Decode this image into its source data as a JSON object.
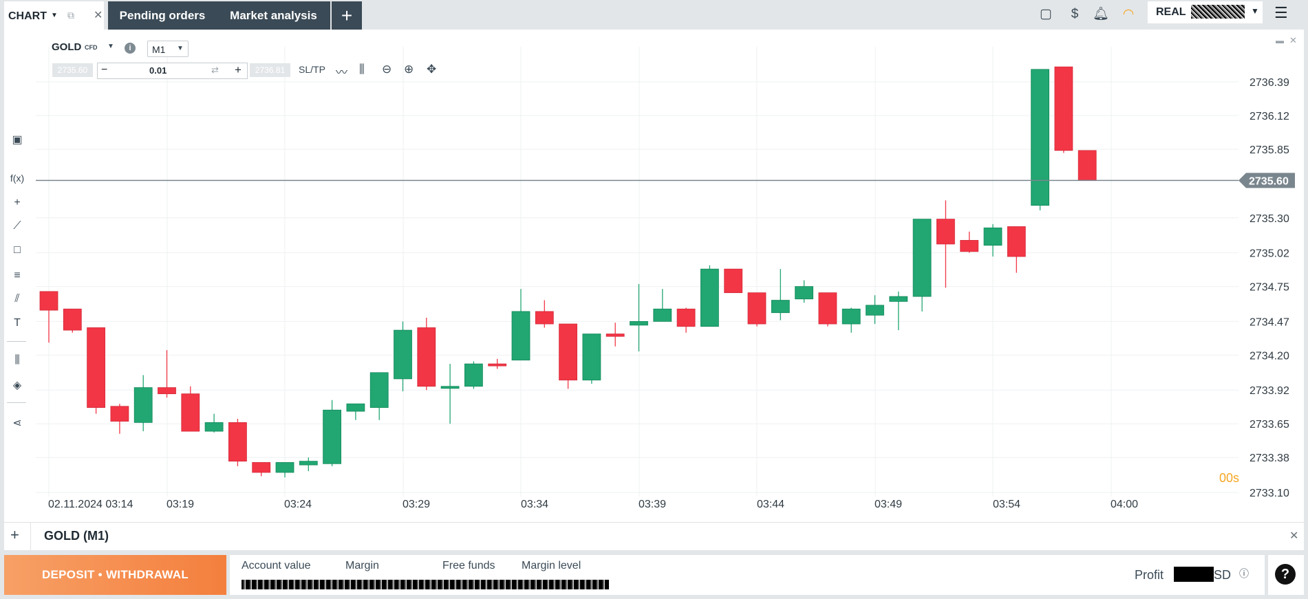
{
  "top_bar": {
    "chart_tab": {
      "label": "CHART",
      "close": "✕",
      "open_external": "⧉"
    },
    "tabs": [
      {
        "label": "Pending orders"
      },
      {
        "label": "Market analysis"
      }
    ],
    "add_tab": "+",
    "icons": [
      "layout-icon",
      "dollar-transfer-icon",
      "bell-icon",
      "signal-icon"
    ],
    "account_type": "REAL",
    "menu": "☰"
  },
  "chart_header": {
    "symbol": "GOLD",
    "type_badge": "CFD",
    "timeframe": "M1",
    "sell_price": "2735.60",
    "buy_price": "2736.81",
    "lot_size": "0.01",
    "lot_minus": "−",
    "lot_plus": "+",
    "lot_swap": "⇄",
    "sltp_label": "SL/TP"
  },
  "left_tools": [
    {
      "name": "chart-type-tool",
      "glyph": "▣"
    },
    {
      "name": "indicators-tool",
      "glyph": "f(x)"
    },
    {
      "name": "crosshair-tool",
      "glyph": "+"
    },
    {
      "name": "trendline-tool",
      "glyph": "⟋"
    },
    {
      "name": "rectangle-tool",
      "glyph": "□"
    },
    {
      "name": "fibonacci-tool",
      "glyph": "≡"
    },
    {
      "name": "pitchfork-tool",
      "glyph": "⫽"
    },
    {
      "name": "text-tool",
      "glyph": "T"
    },
    {
      "name": "candle-settings-tool",
      "glyph": "⫼"
    },
    {
      "name": "layers-tool",
      "glyph": "◈"
    },
    {
      "name": "share-tool",
      "glyph": "⋖"
    }
  ],
  "chart_data": {
    "type": "candlestick",
    "colors": {
      "up": "#22a672",
      "down": "#f23645",
      "current_price_line": "#7a868e"
    },
    "y_ticks": [
      "2736.39",
      "2736.12",
      "2735.85",
      "2735.60",
      "2735.30",
      "2735.02",
      "2734.75",
      "2734.47",
      "2734.20",
      "2733.92",
      "2733.65",
      "2733.38",
      "2733.10"
    ],
    "current_price": "2735.60",
    "x_ticks": [
      "02.11.2024 03:14",
      "03:19",
      "03:24",
      "03:29",
      "03:34",
      "03:39",
      "03:44",
      "03:49",
      "03:54",
      "04:00"
    ],
    "countdown": "00s",
    "candles": [
      {
        "o": 2734.71,
        "h": 2734.71,
        "l": 2734.3,
        "c": 2734.56
      },
      {
        "o": 2734.57,
        "h": 2734.57,
        "l": 2734.38,
        "c": 2734.4
      },
      {
        "o": 2734.42,
        "h": 2734.42,
        "l": 2733.73,
        "c": 2733.78
      },
      {
        "o": 2733.79,
        "h": 2733.81,
        "l": 2733.57,
        "c": 2733.67
      },
      {
        "o": 2733.66,
        "h": 2734.04,
        "l": 2733.59,
        "c": 2733.94
      },
      {
        "o": 2733.94,
        "h": 2734.24,
        "l": 2733.86,
        "c": 2733.89
      },
      {
        "o": 2733.89,
        "h": 2733.95,
        "l": 2733.59,
        "c": 2733.59
      },
      {
        "o": 2733.59,
        "h": 2733.73,
        "l": 2733.58,
        "c": 2733.66
      },
      {
        "o": 2733.66,
        "h": 2733.69,
        "l": 2733.31,
        "c": 2733.35
      },
      {
        "o": 2733.34,
        "h": 2733.34,
        "l": 2733.23,
        "c": 2733.26
      },
      {
        "o": 2733.26,
        "h": 2733.34,
        "l": 2733.22,
        "c": 2733.34
      },
      {
        "o": 2733.32,
        "h": 2733.38,
        "l": 2733.27,
        "c": 2733.35
      },
      {
        "o": 2733.33,
        "h": 2733.84,
        "l": 2733.31,
        "c": 2733.76
      },
      {
        "o": 2733.75,
        "h": 2733.81,
        "l": 2733.68,
        "c": 2733.81
      },
      {
        "o": 2733.78,
        "h": 2734.02,
        "l": 2733.68,
        "c": 2734.06
      },
      {
        "o": 2734.01,
        "h": 2734.47,
        "l": 2733.91,
        "c": 2734.4
      },
      {
        "o": 2734.42,
        "h": 2734.5,
        "l": 2733.92,
        "c": 2733.95
      },
      {
        "o": 2733.94,
        "h": 2734.13,
        "l": 2733.65,
        "c": 2733.95
      },
      {
        "o": 2733.95,
        "h": 2734.15,
        "l": 2733.93,
        "c": 2734.13
      },
      {
        "o": 2734.13,
        "h": 2734.17,
        "l": 2734.09,
        "c": 2734.12
      },
      {
        "o": 2734.16,
        "h": 2734.73,
        "l": 2734.16,
        "c": 2734.55
      },
      {
        "o": 2734.55,
        "h": 2734.64,
        "l": 2734.42,
        "c": 2734.45
      },
      {
        "o": 2734.45,
        "h": 2734.45,
        "l": 2733.93,
        "c": 2734.0
      },
      {
        "o": 2734.0,
        "h": 2734.37,
        "l": 2733.97,
        "c": 2734.37
      },
      {
        "o": 2734.37,
        "h": 2734.46,
        "l": 2734.27,
        "c": 2734.35
      },
      {
        "o": 2734.44,
        "h": 2734.77,
        "l": 2734.23,
        "c": 2734.47
      },
      {
        "o": 2734.47,
        "h": 2734.73,
        "l": 2734.47,
        "c": 2734.57
      },
      {
        "o": 2734.57,
        "h": 2734.58,
        "l": 2734.38,
        "c": 2734.43
      },
      {
        "o": 2734.43,
        "h": 2734.92,
        "l": 2734.43,
        "c": 2734.89
      },
      {
        "o": 2734.89,
        "h": 2734.89,
        "l": 2734.7,
        "c": 2734.7
      },
      {
        "o": 2734.7,
        "h": 2734.7,
        "l": 2734.43,
        "c": 2734.45
      },
      {
        "o": 2734.54,
        "h": 2734.89,
        "l": 2734.48,
        "c": 2734.64
      },
      {
        "o": 2734.65,
        "h": 2734.8,
        "l": 2734.62,
        "c": 2734.75
      },
      {
        "o": 2734.7,
        "h": 2734.7,
        "l": 2734.43,
        "c": 2734.45
      },
      {
        "o": 2734.45,
        "h": 2734.58,
        "l": 2734.38,
        "c": 2734.57
      },
      {
        "o": 2734.52,
        "h": 2734.68,
        "l": 2734.45,
        "c": 2734.6
      },
      {
        "o": 2734.63,
        "h": 2734.71,
        "l": 2734.4,
        "c": 2734.67
      },
      {
        "o": 2734.67,
        "h": 2735.14,
        "l": 2734.55,
        "c": 2735.29
      },
      {
        "o": 2735.29,
        "h": 2735.44,
        "l": 2734.74,
        "c": 2735.09
      },
      {
        "o": 2735.12,
        "h": 2735.19,
        "l": 2735.02,
        "c": 2735.03
      },
      {
        "o": 2735.08,
        "h": 2735.25,
        "l": 2734.99,
        "c": 2735.22
      },
      {
        "o": 2735.23,
        "h": 2735.23,
        "l": 2734.86,
        "c": 2734.99
      },
      {
        "o": 2735.4,
        "h": 2736.48,
        "l": 2735.36,
        "c": 2736.49
      },
      {
        "o": 2736.51,
        "h": 2736.51,
        "l": 2735.82,
        "c": 2735.84
      },
      {
        "o": 2735.84,
        "h": 2735.84,
        "l": 2735.6,
        "c": 2735.6
      }
    ]
  },
  "chart_footer": {
    "add": "+",
    "title": "GOLD (M1)",
    "close": "✕"
  },
  "bottom": {
    "deposit_label": "DEPOSIT • WITHDRAWAL",
    "account_labels": [
      "Account value",
      "Margin",
      "Free funds",
      "Margin level"
    ],
    "profit_label": "Profit",
    "profit_currency_suffix": "SD",
    "help": "?"
  }
}
